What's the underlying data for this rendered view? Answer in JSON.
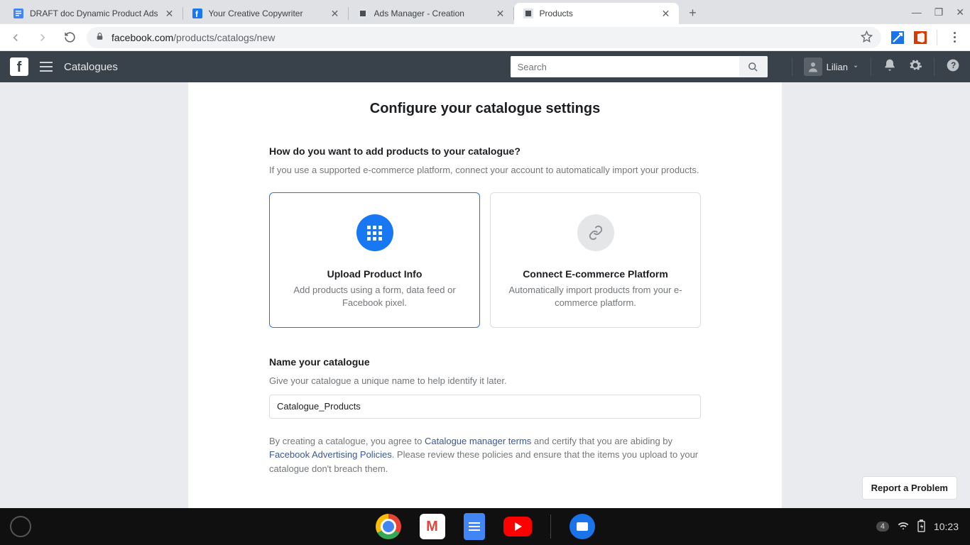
{
  "browser": {
    "tabs": [
      {
        "title": "DRAFT doc Dynamic Product Ads",
        "icon": "docs"
      },
      {
        "title": "Your Creative Copywriter",
        "icon": "fb"
      },
      {
        "title": "Ads Manager - Creation",
        "icon": "fbads"
      },
      {
        "title": "Products",
        "icon": "fbads",
        "active": true
      }
    ],
    "url_domain": "facebook.com",
    "url_path": "/products/catalogs/new"
  },
  "fb": {
    "section": "Catalogues",
    "search_placeholder": "Search",
    "user": "Lilian"
  },
  "page": {
    "title": "Configure your catalogue settings",
    "q1_head": "How do you want to add products to your catalogue?",
    "q1_sub": "If you use a supported e-commerce platform, connect your account to automatically import your products.",
    "cards": [
      {
        "title": "Upload Product Info",
        "desc": "Add products using a form, data feed or Facebook pixel."
      },
      {
        "title": "Connect E-commerce Platform",
        "desc": "Automatically import products from your e-commerce platform."
      }
    ],
    "name_head": "Name your catalogue",
    "name_sub": "Give your catalogue a unique name to help identify it later.",
    "name_value": "Catalogue_Products",
    "legal_1": "By creating a catalogue, you agree to ",
    "legal_link1": "Catalogue manager terms",
    "legal_2": " and certify that you are abiding by ",
    "legal_link2": "Facebook Advertising Policies",
    "legal_3": ". Please review these policies and ensure that the items you upload to your catalogue don't breach them.",
    "report": "Report a Problem"
  },
  "taskbar": {
    "badge": "4",
    "time": "10:23"
  }
}
